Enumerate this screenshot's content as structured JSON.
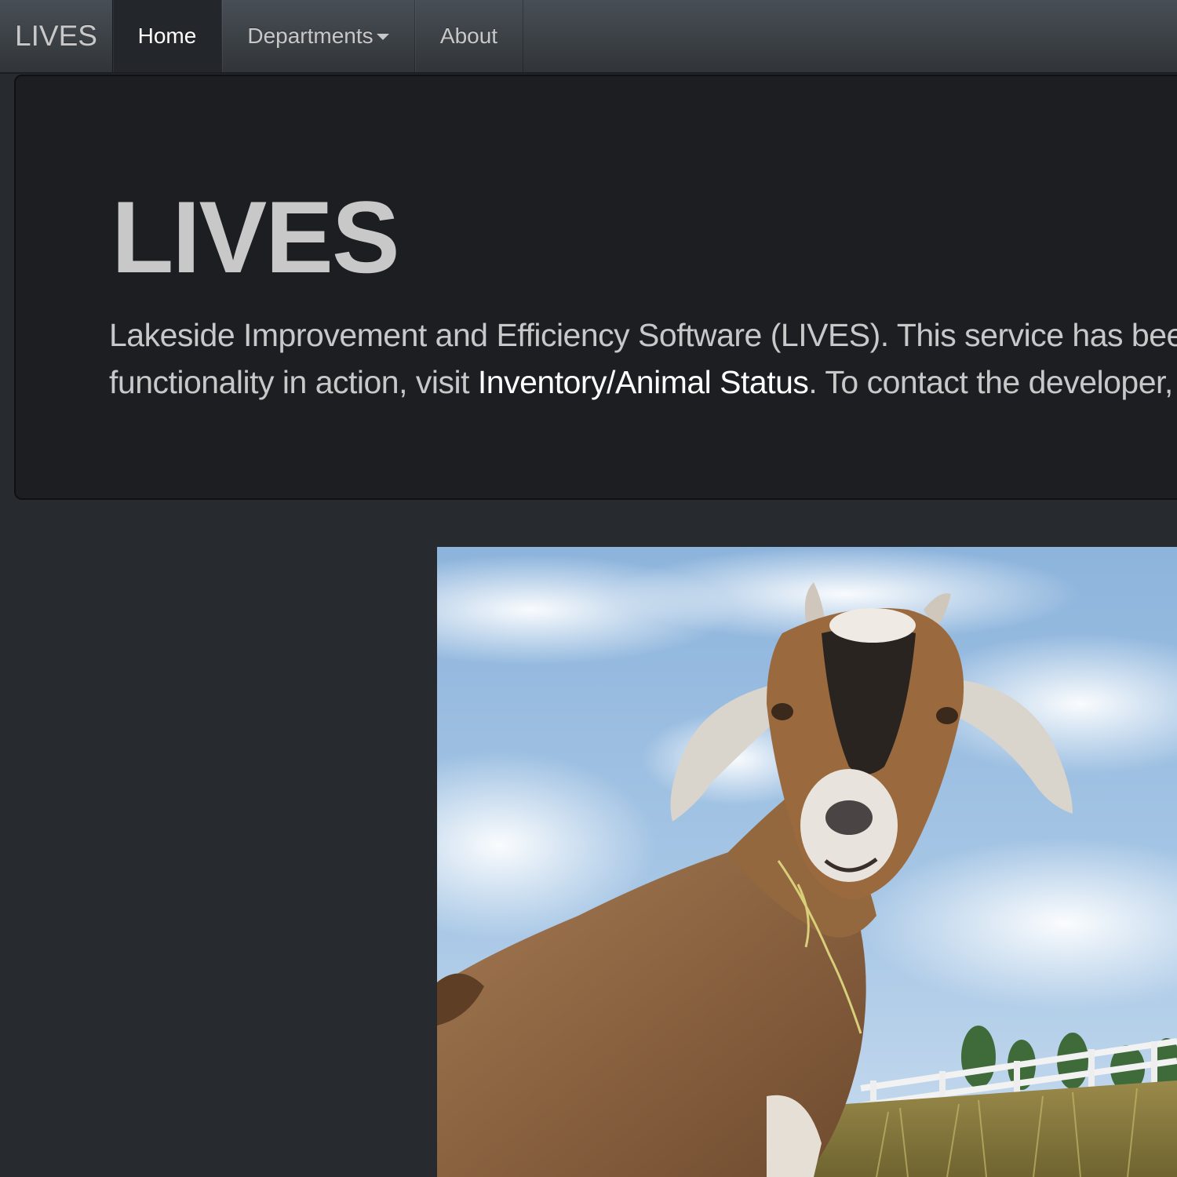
{
  "navbar": {
    "brand": "LIVES",
    "items": [
      {
        "label": "Home",
        "active": true
      },
      {
        "label": "Departments",
        "has_dropdown": true
      },
      {
        "label": "About"
      }
    ]
  },
  "jumbotron": {
    "title": "LIVES",
    "line1": "Lakeside Improvement and Efficiency Software (LIVES). This service has been c",
    "line2_prefix": "functionality in action, visit ",
    "line2_link": "Inventory/Animal Status",
    "line2_suffix": ". To contact the developer, v"
  },
  "colors": {
    "page_background": "#272b30",
    "navbar_background": "#3a3f44",
    "jumbotron_background": "#1c1e22",
    "text": "#c8c8c8",
    "link": "#ffffff"
  },
  "image": {
    "subject": "goat-photo"
  }
}
